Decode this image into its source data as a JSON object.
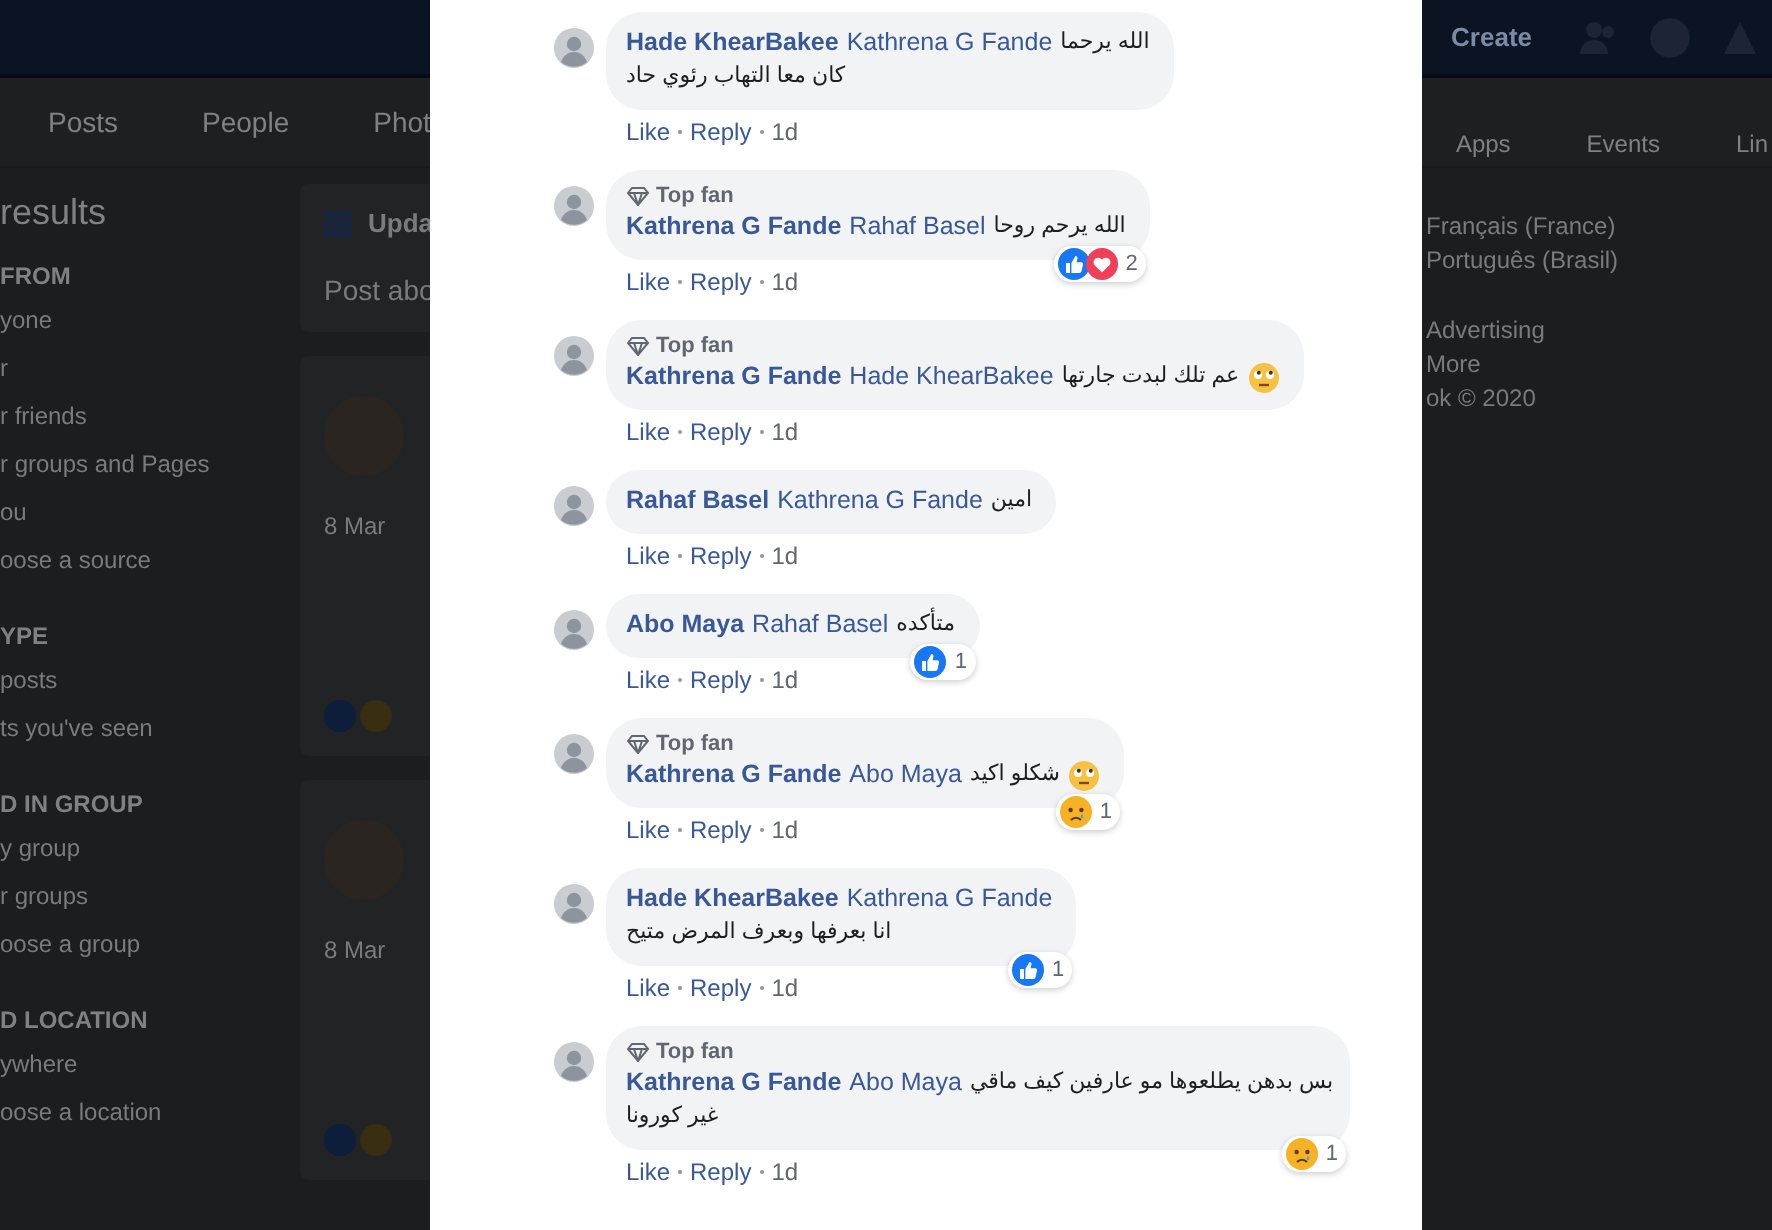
{
  "top_bar": {
    "create_label": "Create"
  },
  "nav_tabs_left": [
    "Posts",
    "People",
    "Phot"
  ],
  "nav_tabs_right": [
    "Apps",
    "Events",
    "Lin"
  ],
  "sidebar": {
    "title": "results",
    "sections": [
      {
        "heading": "FROM",
        "items": [
          "yone",
          "r",
          "r friends",
          "r groups and Pages",
          "ou",
          "oose a source"
        ]
      },
      {
        "heading": "YPE",
        "items": [
          "posts",
          "ts you've seen"
        ]
      },
      {
        "heading": "D IN GROUP",
        "items": [
          "y group",
          "r groups",
          "oose a group"
        ]
      },
      {
        "heading": "D LOCATION",
        "items": [
          "ywhere",
          "oose a location"
        ]
      }
    ]
  },
  "composer": {
    "title": "Upda",
    "prompt": "Post abo"
  },
  "posts": [
    {
      "date": "8 Mar"
    },
    {
      "date": "8 Mar"
    }
  ],
  "footer": {
    "languages_line1": "Français (France)",
    "languages_line2": "Português (Brasil)",
    "links": "Advertising",
    "more": "More",
    "copyright": "ok © 2020"
  },
  "comments": [
    {
      "author": "Hade KhearBakee",
      "mention": "Kathrena G Fande",
      "text": "الله يرحما",
      "more_lines": [
        "كان معا التهاب رئوي حاد"
      ],
      "actions": [
        "Like",
        "Reply"
      ],
      "time": "1d"
    },
    {
      "badge": "Top fan",
      "author": "Kathrena G Fande",
      "mention": "Rahaf Basel",
      "text": "الله يرحم روحا",
      "reactions": [
        {
          "kind": "like"
        },
        {
          "kind": "love"
        }
      ],
      "reaction_count": "2",
      "actions": [
        "Like",
        "Reply"
      ],
      "time": "1d"
    },
    {
      "badge": "Top fan",
      "author": "Kathrena G Fande",
      "mention": "Hade KhearBakee",
      "text": "عم تلك لبدت جارتها",
      "emoji": {
        "kind": "eye-roll"
      },
      "actions": [
        "Like",
        "Reply"
      ],
      "time": "1d"
    },
    {
      "author": "Rahaf Basel",
      "mention": "Kathrena G Fande",
      "text": "امين",
      "actions": [
        "Like",
        "Reply"
      ],
      "time": "1d"
    },
    {
      "author": "Abo Maya",
      "mention": "Rahaf Basel",
      "text": "متأكده",
      "reactions": [
        {
          "kind": "like"
        }
      ],
      "reaction_count": "1",
      "actions": [
        "Like",
        "Reply"
      ],
      "time": "1d"
    },
    {
      "badge": "Top fan",
      "author": "Kathrena G Fande",
      "mention": "Abo Maya",
      "text": "شكلو اكيد",
      "emoji": {
        "kind": "eye-roll"
      },
      "reactions": [
        {
          "kind": "sad"
        }
      ],
      "reaction_count": "1",
      "actions": [
        "Like",
        "Reply"
      ],
      "time": "1d"
    },
    {
      "author": "Hade KhearBakee",
      "mention": "Kathrena G Fande",
      "more_lines": [
        "انا بعرفها وبعرف المرض متيح"
      ],
      "reactions": [
        {
          "kind": "like"
        }
      ],
      "reaction_count": "1",
      "actions": [
        "Like",
        "Reply"
      ],
      "time": "1d"
    },
    {
      "badge": "Top fan",
      "author": "Kathrena G Fande",
      "mention": "Abo Maya",
      "text": "بس بدهن يطلعوها مو عارفين كيف ماقي",
      "more_lines": [
        "غير كورونا"
      ],
      "reactions": [
        {
          "kind": "sad"
        }
      ],
      "reaction_count": "1",
      "actions": [
        "Like",
        "Reply"
      ],
      "time": "1d"
    }
  ]
}
